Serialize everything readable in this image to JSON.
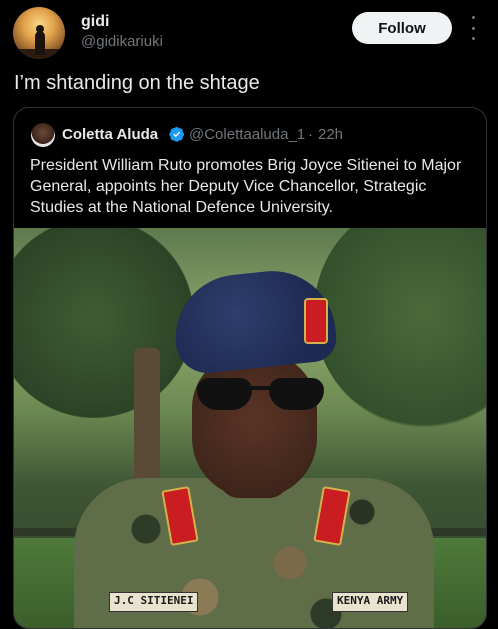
{
  "tweet": {
    "author_name": "gidi",
    "author_handle": "@gidikariuki",
    "follow_label": "Follow",
    "text": "I’m shtanding on the shtage"
  },
  "quoted": {
    "author_name": "Coletta Aluda",
    "author_handle": "@Colettaaluda_1",
    "separator": "·",
    "time": "22h",
    "text": "President William Ruto promotes Brig Joyce Sitienei to Major General, appoints her Deputy Vice Chancellor, Strategic Studies at the National Defence University.",
    "photo": {
      "name_tag": "J.C SITIENEI",
      "country_tag": "KENYA ARMY"
    }
  },
  "colors": {
    "background": "#000000",
    "text": "#e7e9ea",
    "secondary": "#71767b",
    "follow_bg": "#eff3f4",
    "verified": "#1d9bf0",
    "border": "#2f3336"
  },
  "icons": [
    "more-icon",
    "verified-badge-icon"
  ]
}
